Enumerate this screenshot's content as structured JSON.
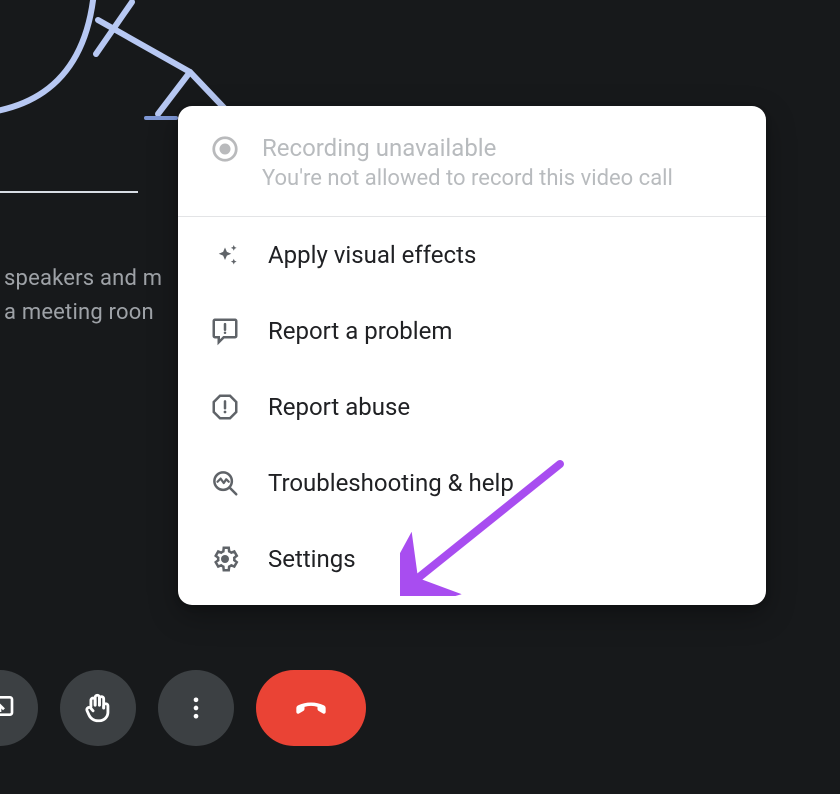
{
  "background": {
    "line1": "speakers and m",
    "line2": "a meeting roon"
  },
  "menu": {
    "disabled": {
      "title": "Recording unavailable",
      "subtitle": "You're not allowed to record this video call"
    },
    "items": [
      {
        "icon": "sparkle-icon",
        "label": "Apply visual effects"
      },
      {
        "icon": "feedback-icon",
        "label": "Report a problem"
      },
      {
        "icon": "report-abuse-icon",
        "label": "Report abuse"
      },
      {
        "icon": "troubleshoot-icon",
        "label": "Troubleshooting & help"
      },
      {
        "icon": "gear-icon",
        "label": "Settings"
      }
    ]
  },
  "toolbar": {
    "buttons": [
      {
        "name": "present-button",
        "icon": "present-icon"
      },
      {
        "name": "raise-hand-button",
        "icon": "hand-icon"
      },
      {
        "name": "more-options-button",
        "icon": "more-vert-icon"
      },
      {
        "name": "end-call-button",
        "icon": "hangup-icon"
      }
    ]
  },
  "annotation": {
    "target": "Settings",
    "color": "#a84df0"
  }
}
